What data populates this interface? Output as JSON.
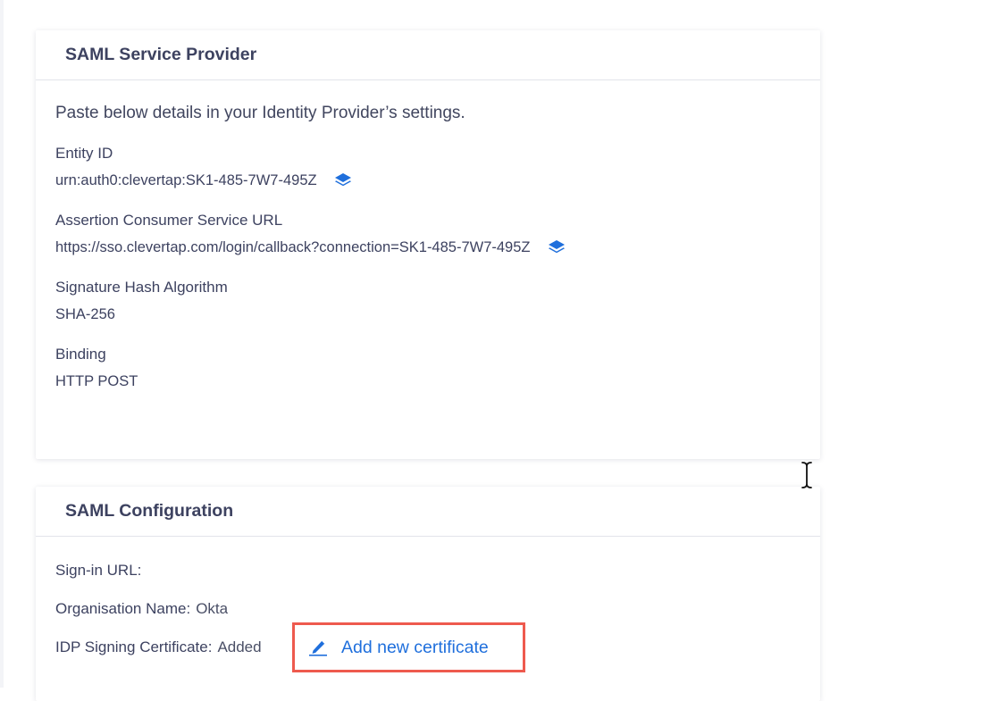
{
  "service_provider": {
    "title": "SAML Service Provider",
    "intro": "Paste below details in your Identity Provider’s settings.",
    "fields": [
      {
        "label": "Entity ID",
        "value": "urn:auth0:clevertap:SK1-485-7W7-495Z",
        "copy_icon": "copy-layers-icon"
      },
      {
        "label": "Assertion Consumer Service URL",
        "value": "https://sso.clevertap.com/login/callback?connection=SK1-485-7W7-495Z",
        "copy_icon": "copy-layers-icon"
      },
      {
        "label": "Signature Hash Algorithm",
        "value": "SHA-256"
      },
      {
        "label": "Binding",
        "value": "HTTP POST"
      }
    ]
  },
  "configuration": {
    "title": "SAML Configuration",
    "sign_in_url_label": "Sign-in URL:",
    "sign_in_url_value": "",
    "organisation_label": "Organisation Name:",
    "organisation_value": "Okta",
    "certificate_label": "IDP Signing Certificate:",
    "certificate_value": "Added",
    "add_certificate_label": "Add new certificate",
    "add_certificate_icon": "pencil-icon"
  },
  "colors": {
    "link": "#1f6fdc",
    "highlight_border": "#ee5a4e",
    "text": "#3d4260"
  }
}
